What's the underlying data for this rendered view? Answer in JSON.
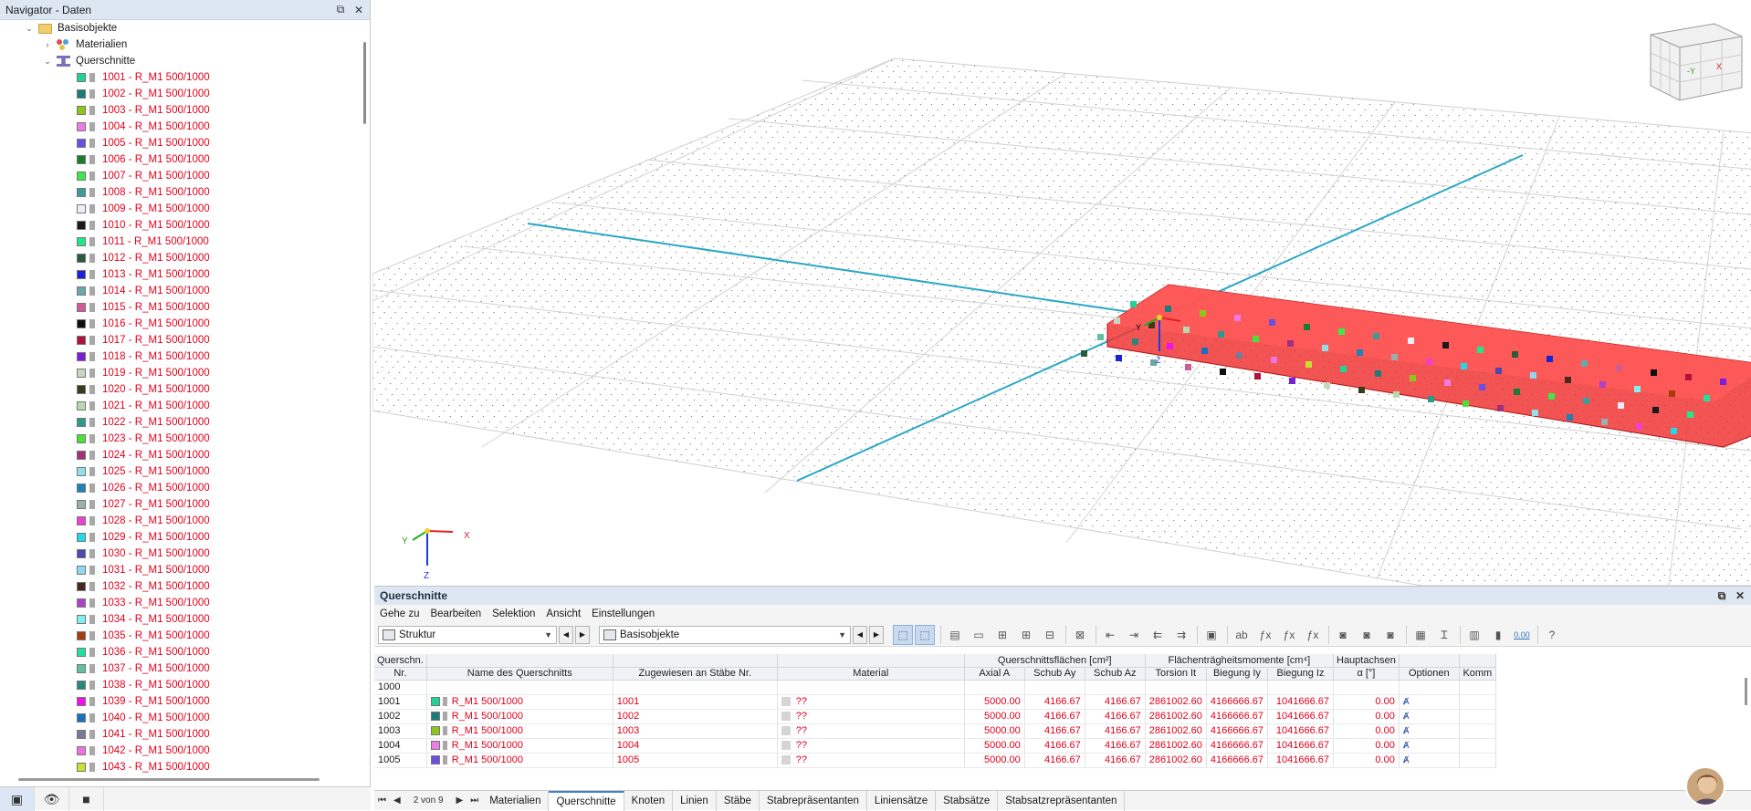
{
  "navigator": {
    "title": "Navigator - Daten",
    "root": "Basisobjekte",
    "materials": "Materialien",
    "sections": "Querschnitte",
    "items": [
      {
        "label": "1001 - R_M1 500/1000",
        "color": "#1fd39a"
      },
      {
        "label": "1002 - R_M1 500/1000",
        "color": "#1b7d7a"
      },
      {
        "label": "1003 - R_M1 500/1000",
        "color": "#8fc41a"
      },
      {
        "label": "1004 - R_M1 500/1000",
        "color": "#f07ae6"
      },
      {
        "label": "1005 - R_M1 500/1000",
        "color": "#6a4fe0"
      },
      {
        "label": "1006 - R_M1 500/1000",
        "color": "#1e7a2d"
      },
      {
        "label": "1007 - R_M1 500/1000",
        "color": "#3ee84a"
      },
      {
        "label": "1008 - R_M1 500/1000",
        "color": "#3d9c96"
      },
      {
        "label": "1009 - R_M1 500/1000",
        "color": "#f2ecf8"
      },
      {
        "label": "1010 - R_M1 500/1000",
        "color": "#1a1a1a"
      },
      {
        "label": "1011 - R_M1 500/1000",
        "color": "#1ee88a"
      },
      {
        "label": "1012 - R_M1 500/1000",
        "color": "#2a5a3c"
      },
      {
        "label": "1013 - R_M1 500/1000",
        "color": "#1a22d8"
      },
      {
        "label": "1014 - R_M1 500/1000",
        "color": "#6aa8a8"
      },
      {
        "label": "1015 - R_M1 500/1000",
        "color": "#d25a96"
      },
      {
        "label": "1016 - R_M1 500/1000",
        "color": "#0e0e12"
      },
      {
        "label": "1017 - R_M1 500/1000",
        "color": "#b0123c"
      },
      {
        "label": "1018 - R_M1 500/1000",
        "color": "#7a1ed8"
      },
      {
        "label": "1019 - R_M1 500/1000",
        "color": "#c8d8c0"
      },
      {
        "label": "1020 - R_M1 500/1000",
        "color": "#3a3a1e"
      },
      {
        "label": "1021 - R_M1 500/1000",
        "color": "#b8d8b0"
      },
      {
        "label": "1022 - R_M1 500/1000",
        "color": "#2a9a8a"
      },
      {
        "label": "1023 - R_M1 500/1000",
        "color": "#4ae03a"
      },
      {
        "label": "1024 - R_M1 500/1000",
        "color": "#a0307a"
      },
      {
        "label": "1025 - R_M1 500/1000",
        "color": "#90e0e8"
      },
      {
        "label": "1026 - R_M1 500/1000",
        "color": "#2080b8"
      },
      {
        "label": "1027 - R_M1 500/1000",
        "color": "#98b0b0"
      },
      {
        "label": "1028 - R_M1 500/1000",
        "color": "#f040d0"
      },
      {
        "label": "1029 - R_M1 500/1000",
        "color": "#20d8e8"
      },
      {
        "label": "1030 - R_M1 500/1000",
        "color": "#4a4ab0"
      },
      {
        "label": "1031 - R_M1 500/1000",
        "color": "#90d8f0"
      },
      {
        "label": "1032 - R_M1 500/1000",
        "color": "#4a2820"
      },
      {
        "label": "1033 - R_M1 500/1000",
        "color": "#b040c8"
      },
      {
        "label": "1034 - R_M1 500/1000",
        "color": "#80f0f0"
      },
      {
        "label": "1035 - R_M1 500/1000",
        "color": "#a83a10"
      },
      {
        "label": "1036 - R_M1 500/1000",
        "color": "#20e0a0"
      },
      {
        "label": "1037 - R_M1 500/1000",
        "color": "#60c0a0"
      },
      {
        "label": "1038 - R_M1 500/1000",
        "color": "#288878"
      },
      {
        "label": "1039 - R_M1 500/1000",
        "color": "#f010e8"
      },
      {
        "label": "1040 - R_M1 500/1000",
        "color": "#1a70c0"
      },
      {
        "label": "1041 - R_M1 500/1000",
        "color": "#7a7a98"
      },
      {
        "label": "1042 - R_M1 500/1000",
        "color": "#f070e0"
      },
      {
        "label": "1043 - R_M1 500/1000",
        "color": "#c8e030"
      }
    ]
  },
  "viewport": {
    "axis_x": "X",
    "axis_y": "Y",
    "axis_z": "Z",
    "small_axis_y": "Y",
    "small_axis_z": "Z",
    "cube_y": "-Y",
    "cube_x": "X",
    "accent_red": "#ff2020",
    "line_cyan": "#20a8c8"
  },
  "panel": {
    "title": "Querschnitte",
    "menu": [
      "Gehe zu",
      "Bearbeiten",
      "Selektion",
      "Ansicht",
      "Einstellungen"
    ],
    "dropdown1": "Struktur",
    "dropdown2": "Basisobjekte",
    "toolbar_value": "0.00",
    "headers": {
      "group_areas": "Querschnittsflächen [cm²]",
      "group_moments": "Flächenträgheitsmomente [cm⁴]",
      "group_axes": "Hauptachsen",
      "col_nr_1": "Querschn.",
      "col_nr_2": "Nr.",
      "col_name": "Name des Querschnitts",
      "col_assigned": "Zugewiesen an Stäbe Nr.",
      "col_material": "Material",
      "col_axial": "Axial A",
      "col_shear_y": "Schub Ay",
      "col_shear_z": "Schub Az",
      "col_torsion": "Torsion It",
      "col_bend_y": "Biegung Iy",
      "col_bend_z": "Biegung Iz",
      "col_alpha": "α [°]",
      "col_options": "Optionen",
      "col_comment": "Komm"
    },
    "rows": [
      {
        "nr": "1000",
        "name": "",
        "color": "",
        "assigned": "",
        "material": "",
        "A": "",
        "Ay": "",
        "Az": "",
        "It": "",
        "Iy": "",
        "Iz": "",
        "alpha": ""
      },
      {
        "nr": "1001",
        "name": "R_M1 500/1000",
        "color": "#1fd39a",
        "assigned": "1001",
        "material": "??",
        "A": "5000.00",
        "Ay": "4166.67",
        "Az": "4166.67",
        "It": "2861002.60",
        "Iy": "4166666.67",
        "Iz": "1041666.67",
        "alpha": "0.00"
      },
      {
        "nr": "1002",
        "name": "R_M1 500/1000",
        "color": "#1b7d7a",
        "assigned": "1002",
        "material": "??",
        "A": "5000.00",
        "Ay": "4166.67",
        "Az": "4166.67",
        "It": "2861002.60",
        "Iy": "4166666.67",
        "Iz": "1041666.67",
        "alpha": "0.00"
      },
      {
        "nr": "1003",
        "name": "R_M1 500/1000",
        "color": "#8fc41a",
        "assigned": "1003",
        "material": "??",
        "A": "5000.00",
        "Ay": "4166.67",
        "Az": "4166.67",
        "It": "2861002.60",
        "Iy": "4166666.67",
        "Iz": "1041666.67",
        "alpha": "0.00"
      },
      {
        "nr": "1004",
        "name": "R_M1 500/1000",
        "color": "#f07ae6",
        "assigned": "1004",
        "material": "??",
        "A": "5000.00",
        "Ay": "4166.67",
        "Az": "4166.67",
        "It": "2861002.60",
        "Iy": "4166666.67",
        "Iz": "1041666.67",
        "alpha": "0.00"
      },
      {
        "nr": "1005",
        "name": "R_M1 500/1000",
        "color": "#6a4fe0",
        "assigned": "1005",
        "material": "??",
        "A": "5000.00",
        "Ay": "4166.67",
        "Az": "4166.67",
        "It": "2861002.60",
        "Iy": "4166666.67",
        "Iz": "1041666.67",
        "alpha": "0.00"
      }
    ],
    "pager": "2 von 9",
    "tabs": [
      "Materialien",
      "Querschnitte",
      "Knoten",
      "Linien",
      "Stäbe",
      "Stabrepräsentanten",
      "Liniensätze",
      "Stabsätze",
      "Stabsatzrepräsentanten"
    ],
    "active_tab": "Querschnitte"
  }
}
